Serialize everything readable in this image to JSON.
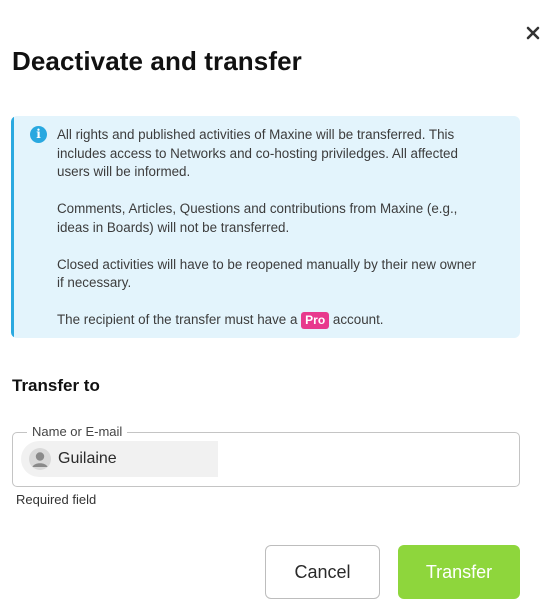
{
  "dialog": {
    "title": "Deactivate and transfer",
    "close_icon": "close-icon"
  },
  "info": {
    "icon": "info-icon",
    "accent_color": "#2aa9e0",
    "background_color": "#e3f4fc",
    "paragraph_1": "All rights and published activities of Maxine will be transferred. This includes access to Networks and co-hosting priviledges. All affected users will be informed.",
    "paragraph_2": "Comments, Articles, Questions and contributions from Maxine (e.g., ideas in Boards) will not be transferred.",
    "paragraph_3": "Closed activities will have to be reopened manually by their new owner if necessary.",
    "paragraph_4_before": "The recipient of the transfer must have a",
    "pro_badge": "Pro",
    "pro_badge_color": "#e8398d",
    "paragraph_4_after": "account."
  },
  "transfer": {
    "section_title": "Transfer to",
    "field_label": "Name or E-mail",
    "selected_user": "Guilaine",
    "avatar_icon": "user-avatar-icon",
    "helper_text": "Required field"
  },
  "actions": {
    "cancel_label": "Cancel",
    "transfer_label": "Transfer",
    "transfer_color": "#8ed63c"
  }
}
